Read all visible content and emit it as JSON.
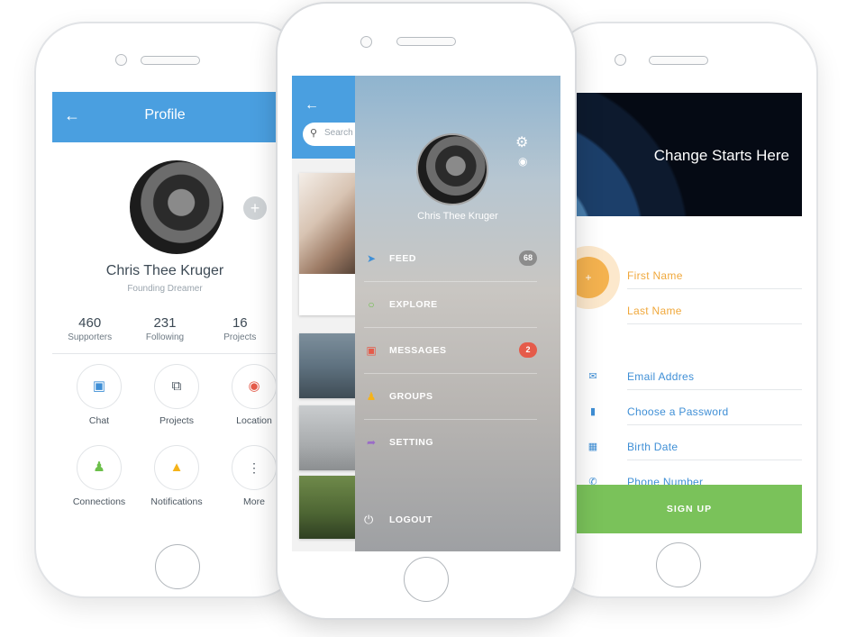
{
  "profile_screen": {
    "title": "Profile",
    "name": "Chris Thee Kruger",
    "tagline": "Founding Dreamer",
    "stats": [
      {
        "value": "460",
        "label": "Supporters"
      },
      {
        "value": "231",
        "label": "Following"
      },
      {
        "value": "16",
        "label": "Projects"
      }
    ],
    "actions": [
      {
        "label": "Chat",
        "icon": "chat-icon",
        "color": "#3f8fd6"
      },
      {
        "label": "Projects",
        "icon": "projects-icon",
        "color": "#4b5660"
      },
      {
        "label": "Location",
        "icon": "location-pin-icon",
        "color": "#e55b4a"
      },
      {
        "label": "Connections",
        "icon": "connections-icon",
        "color": "#6cbf4a"
      },
      {
        "label": "Notifications",
        "icon": "bell-icon",
        "color": "#f5b31a"
      },
      {
        "label": "More",
        "icon": "more-vertical-icon",
        "color": "#4b5660"
      }
    ]
  },
  "drawer_screen": {
    "search_placeholder": "Search",
    "user_name": "Chris Thee Kruger",
    "menu": [
      {
        "label": "FEED",
        "icon": "feed-bolt-icon",
        "color": "#3f8fd6",
        "badge": "68",
        "badge_color": "#8c8c8c"
      },
      {
        "label": "EXPLORE",
        "icon": "explore-globe-icon",
        "color": "#6cbf4a",
        "badge": "",
        "badge_color": ""
      },
      {
        "label": "MESSAGES",
        "icon": "messages-icon",
        "color": "#e55b4a",
        "badge": "2",
        "badge_color": "#e55b4a"
      },
      {
        "label": "GROUPS",
        "icon": "groups-icon",
        "color": "#f5b31a",
        "badge": "",
        "badge_color": ""
      },
      {
        "label": "SETTING",
        "icon": "setting-share-icon",
        "color": "#9a6cc7",
        "badge": "",
        "badge_color": ""
      }
    ],
    "logout_label": "LOGOUT"
  },
  "signup_screen": {
    "hero_text": "Change Starts Here",
    "fields": [
      {
        "label": "First Name",
        "color": "#f0a83c",
        "icon": ""
      },
      {
        "label": "Last Name",
        "color": "#f0a83c",
        "icon": ""
      },
      {
        "label": "Email Addres",
        "color": "#3f8fd6",
        "icon": "email-icon"
      },
      {
        "label": "Choose a Password",
        "color": "#3f8fd6",
        "icon": "lock-icon"
      },
      {
        "label": "Birth Date",
        "color": "#3f8fd6",
        "icon": "calendar-icon"
      },
      {
        "label": "Phone Number",
        "color": "#3f8fd6",
        "icon": "phone-icon"
      }
    ],
    "signup_label": "SIGN UP"
  },
  "colors": {
    "primary_blue": "#4a9fe0",
    "signup_green": "#7ac25a",
    "accent_orange": "#f0a83c"
  }
}
